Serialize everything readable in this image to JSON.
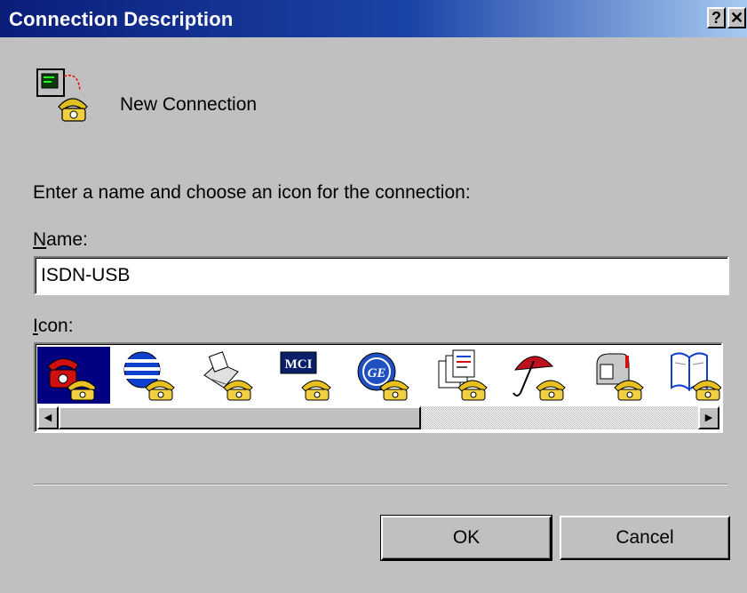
{
  "window": {
    "title": "Connection Description",
    "help_label": "?",
    "close_label": "✕"
  },
  "header": {
    "connection_icon": "phone-computer-icon",
    "connection_name": "New Connection"
  },
  "form": {
    "instruction": "Enter a name and choose an icon for the connection:",
    "name_label_mnemonic": "N",
    "name_label_rest": "ame:",
    "name_value": "ISDN-USB",
    "icon_label_mnemonic": "I",
    "icon_label_rest": "con:"
  },
  "icons": [
    {
      "name": "red-telephone-icon",
      "selected": true
    },
    {
      "name": "globe-icon",
      "selected": false
    },
    {
      "name": "fax-machine-icon",
      "selected": false
    },
    {
      "name": "mci-logo-icon",
      "selected": false
    },
    {
      "name": "ge-logo-icon",
      "selected": false
    },
    {
      "name": "documents-icon",
      "selected": false
    },
    {
      "name": "umbrella-icon",
      "selected": false
    },
    {
      "name": "mailbox-icon",
      "selected": false
    },
    {
      "name": "open-book-icon",
      "selected": false
    }
  ],
  "icon_text": {
    "mci": "MCI",
    "ge": "GE"
  },
  "scrollbar": {
    "left_arrow": "◀",
    "right_arrow": "▶"
  },
  "buttons": {
    "ok": "OK",
    "cancel": "Cancel"
  },
  "colors": {
    "face": "#c0c0c0",
    "title_start": "#0a1e7a",
    "title_end": "#a6caf0",
    "selection": "#000080"
  }
}
